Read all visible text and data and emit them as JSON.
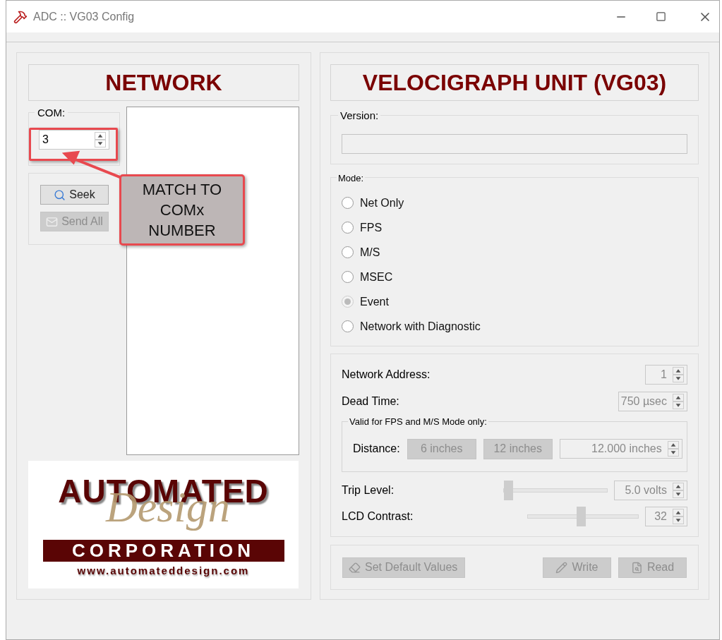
{
  "window": {
    "title": "ADC :: VG03 Config"
  },
  "network": {
    "heading": "NETWORK",
    "com": {
      "label": "COM:",
      "value": "3"
    },
    "buttons": [
      {
        "label": "Seek",
        "disabled": false
      },
      {
        "label": "Send All",
        "disabled": true
      }
    ],
    "logo": {
      "top": "AUTOMATED",
      "script": "Design",
      "band": "CORPORATION",
      "url": "www.automateddesign.com"
    }
  },
  "annotation": {
    "lines": [
      "MATCH TO",
      "COMx",
      "NUMBER"
    ]
  },
  "unit": {
    "heading": "VELOCIGRAPH UNIT (VG03)",
    "version": {
      "label": "Version:"
    },
    "mode": {
      "label": "Mode:",
      "options": [
        {
          "label": "Net Only",
          "selected": false,
          "disabled": false
        },
        {
          "label": "FPS",
          "selected": false,
          "disabled": false
        },
        {
          "label": "M/S",
          "selected": false,
          "disabled": false
        },
        {
          "label": "MSEC",
          "selected": false,
          "disabled": false
        },
        {
          "label": "Event",
          "selected": true,
          "disabled": true
        },
        {
          "label": "Network with Diagnostic",
          "selected": false,
          "disabled": false
        }
      ]
    },
    "network_address": {
      "label": "Network Address:",
      "value": "1"
    },
    "dead_time": {
      "label": "Dead Time:",
      "value": "750 µsec"
    },
    "distance": {
      "legend": "Valid for FPS and M/S Mode only:",
      "label": "Distance:",
      "presets": [
        "6 inches",
        "12 inches"
      ],
      "value": "12.000 inches"
    },
    "trip_level": {
      "label": "Trip Level:",
      "value": "5.0 volts",
      "level": 0
    },
    "lcd_contrast": {
      "label": "LCD Contrast:",
      "value": "32",
      "level": 0.48
    },
    "actions": [
      {
        "label": "Set Default Values",
        "disabled": true
      },
      {
        "label": "Write",
        "disabled": true
      },
      {
        "label": "Read",
        "disabled": true
      }
    ]
  }
}
